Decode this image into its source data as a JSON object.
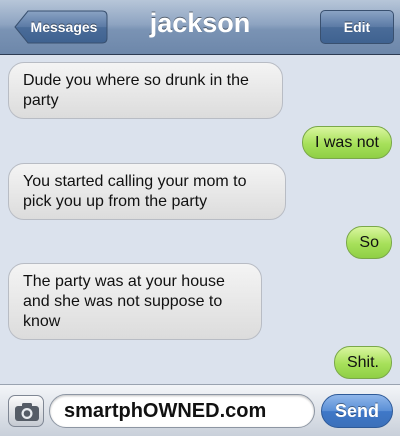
{
  "navbar": {
    "back_label": "Messages",
    "title": "jackson",
    "edit_label": "Edit"
  },
  "messages": [
    {
      "side": "received",
      "lines": [
        "Dude you where so drunk in the",
        "party"
      ]
    },
    {
      "side": "sent",
      "lines": [
        "I was not"
      ]
    },
    {
      "side": "received",
      "lines": [
        "You started calling your mom to",
        "pick you up from the party"
      ]
    },
    {
      "side": "sent",
      "lines": [
        "So"
      ]
    },
    {
      "side": "received",
      "lines": [
        "The party was at your house",
        "and she was not suppose to",
        "know"
      ]
    },
    {
      "side": "sent",
      "lines": [
        "Shit."
      ]
    }
  ],
  "composer": {
    "camera_icon": "camera-icon",
    "input_value": "smartphOWNED.com",
    "send_label": "Send"
  },
  "colors": {
    "navbar": "#7a93b4",
    "background": "#dbe2ed",
    "sent_bubble": "#a6e05a",
    "received_bubble": "#e8e8e8",
    "send_button": "#4a80cc"
  }
}
